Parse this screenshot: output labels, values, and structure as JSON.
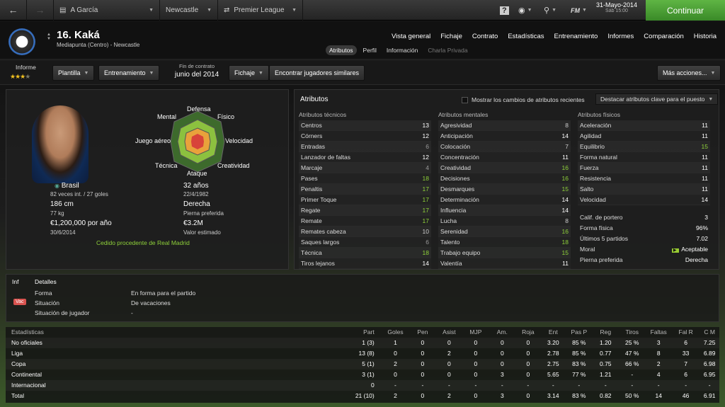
{
  "topbar": {
    "manager": "A García",
    "club": "Newcastle",
    "competition": "Premier League",
    "date": "31-Mayo-2014",
    "day_time": "Sáb 15:00",
    "continue_label": "Continuar",
    "fm_label": "FM"
  },
  "player": {
    "name": "16. Kaká",
    "position": "Mediapunta (Centro) - Newcastle"
  },
  "main_nav": [
    "Vista general",
    "Fichaje",
    "Contrato",
    "Estadísticas",
    "Entrenamiento",
    "Informes",
    "Comparación",
    "Historia"
  ],
  "sub_nav": [
    "Atributos",
    "Perfil",
    "Información",
    "Charla Privada"
  ],
  "toolbar": {
    "informe": "Informe",
    "plantilla": "Plantilla",
    "entrenamiento": "Entrenamiento",
    "contract_label": "Fin de contrato",
    "contract_value": "junio del 2014",
    "fichaje": "Fichaje",
    "find_similar": "Encontrar jugadores similares",
    "more_actions": "Más acciones..."
  },
  "radar": {
    "top": "Defensa",
    "tl": "Mental",
    "tr": "Físico",
    "l": "Juego aéreo",
    "r": "Velocidad",
    "bl": "Técnica",
    "br": "Creatividad",
    "bottom": "Ataque"
  },
  "bio": {
    "nationality": "Brasil",
    "caps": "82 veces int. / 27 goles",
    "age": "32 años",
    "dob": "22/4/1982",
    "height": "186 cm",
    "foot": "Derecha",
    "weight": "77 kg",
    "foot_label": "Pierna preferida",
    "wage": "€1,200,000 por año",
    "value": "€3.2M",
    "expiry": "30/6/2014",
    "value_label": "Valor estimado",
    "loan": "Cedido procedente de Real Madrid"
  },
  "attributes": {
    "title": "Atributos",
    "show_changes": "Mostrar los cambios de atributos recientes",
    "highlight": "Destacar atributos clave para el puesto",
    "tech_title": "Atributos técnicos",
    "mental_title": "Atributos mentales",
    "phys_title": "Atributos físicos",
    "technical": [
      [
        "Centros",
        "13"
      ],
      [
        "Córners",
        "12"
      ],
      [
        "Entradas",
        "6"
      ],
      [
        "Lanzador de faltas",
        "12"
      ],
      [
        "Marcaje",
        "4"
      ],
      [
        "Pases",
        "18"
      ],
      [
        "Penaltis",
        "17"
      ],
      [
        "Primer Toque",
        "17"
      ],
      [
        "Regate",
        "17"
      ],
      [
        "Remate",
        "17"
      ],
      [
        "Remates cabeza",
        "10"
      ],
      [
        "Saques largos",
        "6"
      ],
      [
        "Técnica",
        "18"
      ],
      [
        "Tiros lejanos",
        "14"
      ]
    ],
    "mental": [
      [
        "Agresividad",
        "8"
      ],
      [
        "Anticipación",
        "14"
      ],
      [
        "Colocación",
        "7"
      ],
      [
        "Concentración",
        "11"
      ],
      [
        "Creatividad",
        "16"
      ],
      [
        "Decisiones",
        "16"
      ],
      [
        "Desmarques",
        "15"
      ],
      [
        "Determinación",
        "14"
      ],
      [
        "Influencia",
        "14"
      ],
      [
        "Lucha",
        "8"
      ],
      [
        "Serenidad",
        "16"
      ],
      [
        "Talento",
        "18"
      ],
      [
        "Trabajo equipo",
        "15"
      ],
      [
        "Valentía",
        "11"
      ]
    ],
    "physical": [
      [
        "Aceleración",
        "11"
      ],
      [
        "Agilidad",
        "11"
      ],
      [
        "Equilibrio",
        "15"
      ],
      [
        "Forma natural",
        "11"
      ],
      [
        "Fuerza",
        "11"
      ],
      [
        "Resistencia",
        "11"
      ],
      [
        "Salto",
        "11"
      ],
      [
        "Velocidad",
        "14"
      ]
    ],
    "extra": [
      [
        "Calif. de portero",
        "3"
      ],
      [
        "Forma física",
        "96%"
      ],
      [
        "Últimos 5 partidos",
        "7.02"
      ],
      [
        "Moral",
        "Aceptable"
      ],
      [
        "Pierna preferida",
        "Derecha"
      ]
    ]
  },
  "details": {
    "inf": "Inf",
    "title": "Detalles",
    "badge": "Vac",
    "rows": [
      [
        "Forma",
        "En forma para el partido"
      ],
      [
        "Situación",
        "De vacaciones"
      ],
      [
        "Situación de jugador",
        "-"
      ]
    ]
  },
  "stats": {
    "headers": [
      "Estadísticas",
      "Part",
      "Goles",
      "Pen",
      "Asist",
      "MJP",
      "Am.",
      "Roja",
      "Ent",
      "Pas P",
      "Reg",
      "Tiros",
      "Faltas",
      "Fal R",
      "C M"
    ],
    "rows": [
      [
        "No oficiales",
        "1 (3)",
        "1",
        "0",
        "0",
        "0",
        "0",
        "0",
        "3.20",
        "85 %",
        "1.20",
        "25 %",
        "3",
        "6",
        "7.25"
      ],
      [
        "Liga",
        "13 (8)",
        "0",
        "0",
        "2",
        "0",
        "0",
        "0",
        "2.78",
        "85 %",
        "0.77",
        "47 %",
        "8",
        "33",
        "6.89"
      ],
      [
        "Copa",
        "5 (1)",
        "2",
        "0",
        "0",
        "0",
        "0",
        "0",
        "2.75",
        "83 %",
        "0.75",
        "66 %",
        "2",
        "7",
        "6.98"
      ],
      [
        "Continental",
        "3 (1)",
        "0",
        "0",
        "0",
        "0",
        "3",
        "0",
        "5.65",
        "77 %",
        "1.21",
        "-",
        "4",
        "6",
        "6.95"
      ],
      [
        "Internacional",
        "0",
        "-",
        "-",
        "-",
        "-",
        "-",
        "-",
        "-",
        "-",
        "-",
        "-",
        "-",
        "-",
        "-"
      ],
      [
        "Total",
        "21 (10)",
        "2",
        "0",
        "2",
        "0",
        "3",
        "0",
        "3.14",
        "83 %",
        "0.82",
        "50 %",
        "14",
        "46",
        "6.91"
      ]
    ]
  },
  "colors": {
    "accent": "#8fd23a",
    "continue": "#4ea236",
    "badge": "#d9534f"
  }
}
